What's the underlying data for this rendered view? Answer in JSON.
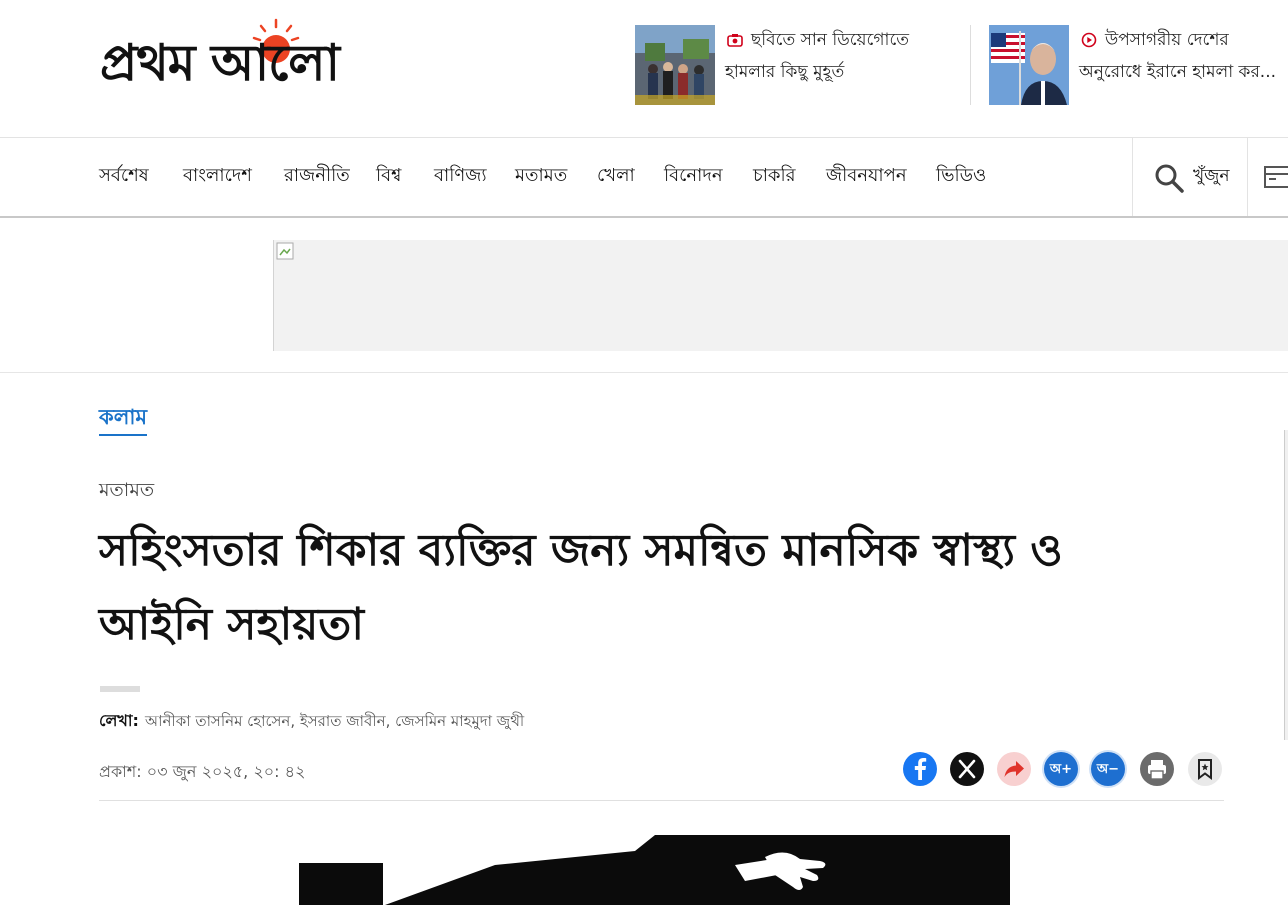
{
  "brand": {
    "logo_text": "প্রথম আলো",
    "accent_color": "#ec4323"
  },
  "teasers": [
    {
      "icon": "camera-icon",
      "line1": "ছবিতে সান ডিয়েগোতে",
      "line2": "হামলার কিছু মুহূর্ত"
    },
    {
      "icon": "video-play-icon",
      "line1": "উপসাগরীয় দেশের",
      "line2": "অনুরোধে ইরানে হামলা কর..."
    }
  ],
  "nav": {
    "items": [
      "সর্বশেষ",
      "বাংলাদেশ",
      "রাজনীতি",
      "বিশ্ব",
      "বাণিজ্য",
      "মতামত",
      "খেলা",
      "বিনোদন",
      "চাকরি",
      "জীবনযাপন",
      "ভিডিও"
    ],
    "search_label": "খুঁজুন"
  },
  "article": {
    "category_tag": "কলাম",
    "section": "মতামত",
    "headline": "সহিংসতার শিকার ব্যক্তির জন্য সমন্বিত মানসিক স্বাস্থ্য ও আইনি সহায়তা",
    "byline_label": "লেখা:",
    "authors": "আনীকা তাসনিম হোসেন, ইসরাত জাবীন, জেসমিন মাহমুদা জুথী",
    "published": "প্রকাশ: ০৩ জুন ২০২৫, ২০: ৪২"
  },
  "share": {
    "buttons": [
      {
        "icon": "facebook-icon",
        "color": "#1877f2"
      },
      {
        "icon": "x-icon",
        "color": "#111111"
      },
      {
        "icon": "share-icon",
        "color": "#f6c4c4"
      },
      {
        "icon": "font-increase-icon",
        "label": "অ+",
        "color": "#1e6fd0"
      },
      {
        "icon": "font-decrease-icon",
        "label": "অ−",
        "color": "#1e6fd0"
      },
      {
        "icon": "print-icon",
        "color": "#6b6b6b"
      },
      {
        "icon": "bookmark-icon",
        "color": "#e9e9e9"
      }
    ]
  }
}
